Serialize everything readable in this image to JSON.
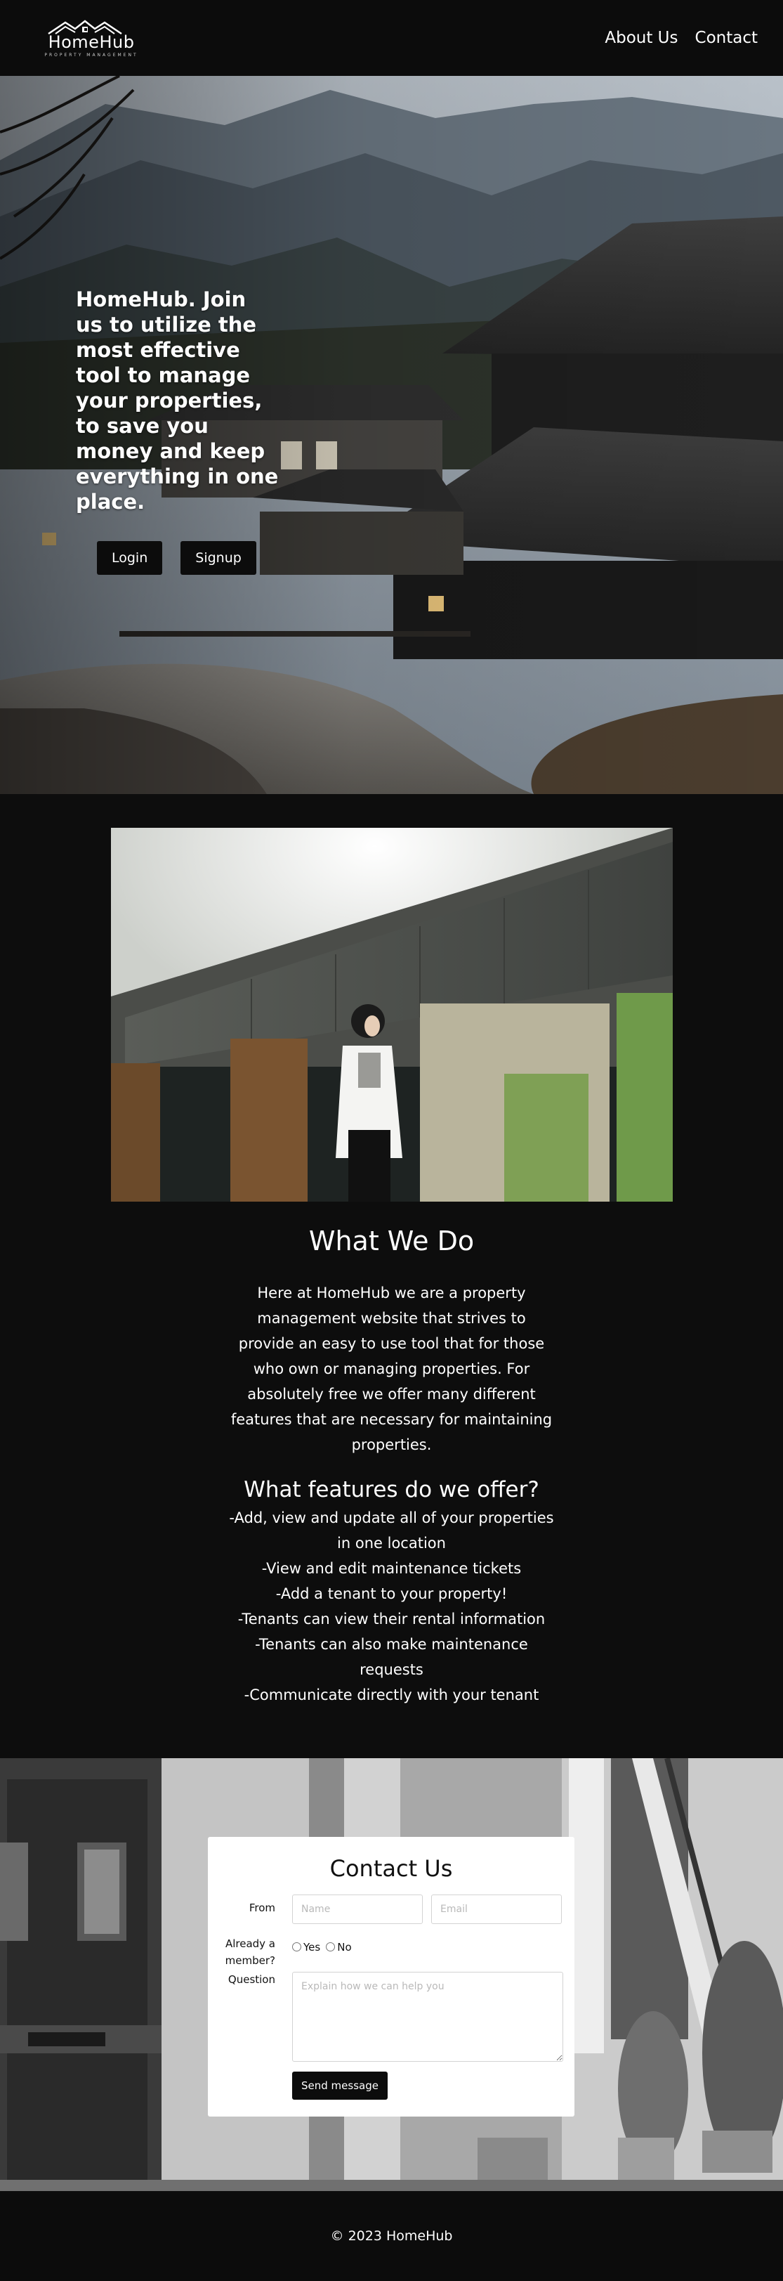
{
  "nav": {
    "logo_name": "HomeHub",
    "logo_tagline": "PROPERTY MANAGEMENT",
    "links": [
      "About Us",
      "Contact"
    ]
  },
  "hero": {
    "title": "HomeHub. Join us to utilize the most effective tool to manage your properties, to save you money and keep everything in one place.",
    "login_label": "Login",
    "signup_label": "Signup"
  },
  "about": {
    "heading": "What We Do",
    "body": "Here at HomeHub we are a property management website that strives to provide an easy to use tool that for those who own or managing properties. For absolutely free we offer many different features that are necessary for maintaining properties.",
    "features_heading": "What features do we offer?",
    "features": [
      "-Add, view and update all of your properties in one location",
      "-View and edit maintenance tickets",
      "-Add a tenant to your property!",
      "-Tenants can view their rental information",
      "-Tenants can also make maintenance requests",
      "-Communicate directly with your tenant"
    ]
  },
  "contact": {
    "heading": "Contact Us",
    "from_label": "From",
    "name_placeholder": "Name",
    "email_placeholder": "Email",
    "member_label": "Already a member?",
    "yes_label": "Yes",
    "no_label": "No",
    "question_label": "Question",
    "question_placeholder": "Explain how we can help you",
    "send_label": "Send message"
  },
  "footer": {
    "text": "© 2023 HomeHub"
  },
  "colors": {
    "background": "#0d0d0d",
    "button": "#0c0c0c",
    "text": "#ffffff",
    "card": "#ffffff"
  }
}
